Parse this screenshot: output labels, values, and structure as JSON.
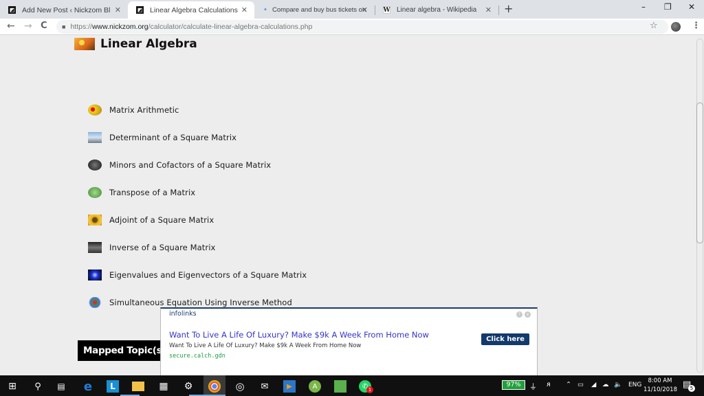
{
  "browser": {
    "tabs": [
      {
        "title": "Add New Post ‹ Nickzom Blog —",
        "favicon": "nickzom-icon",
        "active": false
      },
      {
        "title": "Linear Algebra Calculations",
        "favicon": "nickzom-icon",
        "active": true
      },
      {
        "title": "Compare and buy bus tickets onl",
        "favicon": "loading-dot-icon",
        "active": false
      },
      {
        "title": "Linear algebra - Wikipedia",
        "favicon": "wikipedia-icon",
        "active": false
      }
    ],
    "tab_close_glyph": "✕",
    "new_tab_glyph": "+",
    "window_controls": {
      "minimize": "–",
      "restore": "❐",
      "close": "✕"
    },
    "nav": {
      "back": "←",
      "forward": "→",
      "reload": "C"
    },
    "url": {
      "scheme": "https://",
      "domain": "www.nickzom.org",
      "path": "/calculator/calculate-linear-algebra-calculations.php"
    },
    "lock_glyph": "🔒",
    "star_glyph": "☆",
    "menu_glyph": "⋮"
  },
  "page": {
    "title": "Linear Algebra",
    "topics": [
      {
        "label": "Matrix Arithmetic",
        "icon": "ball-icon"
      },
      {
        "label": "Determinant of a Square Matrix",
        "icon": "city-icon"
      },
      {
        "label": "Minors and Cofactors of a Square Matrix",
        "icon": "clock-icon"
      },
      {
        "label": "Transpose of a Matrix",
        "icon": "green-circle-icon"
      },
      {
        "label": "Adjoint of a Square Matrix",
        "icon": "sunflower-icon"
      },
      {
        "label": "Inverse of a Square Matrix",
        "icon": "grid-icon"
      },
      {
        "label": "Eigenvalues and Eigenvectors of a Square Matrix",
        "icon": "blue-light-icon"
      },
      {
        "label": "Simultaneous Equation Using Inverse Method",
        "icon": "star-polyhedron-icon"
      }
    ],
    "mapped_topics_label": "Mapped Topic(s)"
  },
  "ad": {
    "brand": "infolinks",
    "help_glyph": "?",
    "close_glyph": "x",
    "title": "Want To Live A Life Of Luxury? Make $9k A Week From Home Now",
    "subtitle": "Want To Live A Life Of Luxury? Make $9k A Week From Home Now",
    "url": "secure.calch.gdn",
    "cta": "Click here"
  },
  "taskbar": {
    "battery": "97%",
    "language": "ENG",
    "time": "8:00 AM",
    "date": "11/10/2018",
    "notifications": "5",
    "whatsapp_badge": "1"
  }
}
